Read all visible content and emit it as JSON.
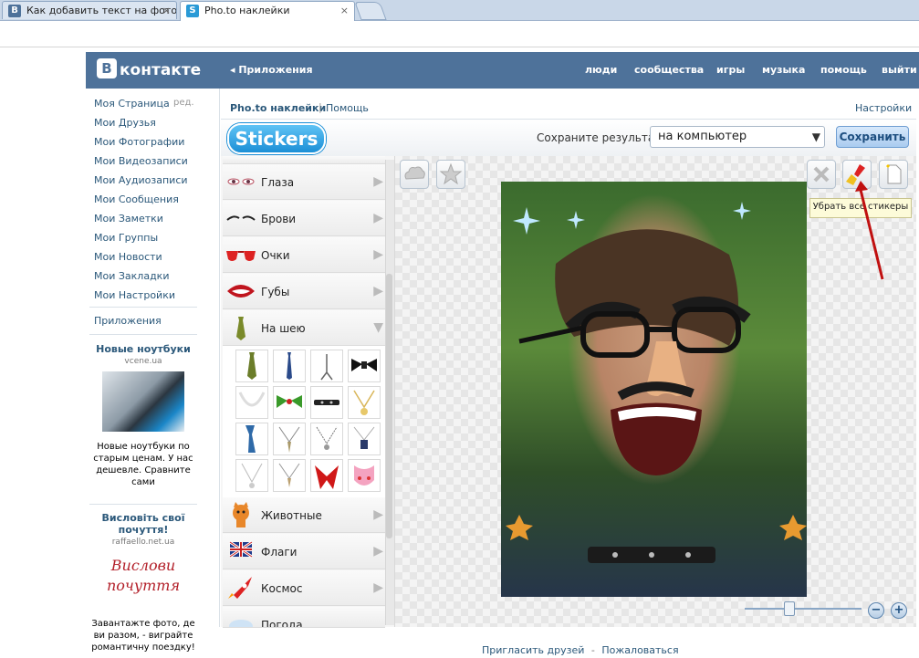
{
  "browser": {
    "tabs": [
      {
        "favicon": "B",
        "title": "Как добавить текст на фото",
        "active": false,
        "favicon_color": "#4e729a"
      },
      {
        "favicon": "S",
        "title": "Pho.to наклейки",
        "active": true,
        "favicon_color": "#2a9ad6"
      }
    ],
    "close_glyph": "×"
  },
  "vk": {
    "logo_letter": "В",
    "logo_text": "контакте",
    "apps_label": "◂ Приложения",
    "nav": [
      "люди",
      "сообщества",
      "игры",
      "музыка",
      "помощь",
      "выйти"
    ],
    "menu": [
      "Моя Страница",
      "Мои Друзья",
      "Мои Фотографии",
      "Мои Видеозаписи",
      "Мои Аудиозаписи",
      "Мои Сообщения",
      "Мои Заметки",
      "Мои Группы",
      "Мои Новости",
      "Мои Закладки",
      "Мои Настройки"
    ],
    "menu_edit": "ред.",
    "apps_menu": "Приложения",
    "ads": [
      {
        "title": "Новые ноутбуки",
        "site": "vcene.ua",
        "text": "Новые ноутбуки по старым ценам. У нас дешевле. Сравните сами"
      },
      {
        "title": "Висловіть свої почуття!",
        "site": "raffaello.net.ua",
        "image_text": "Вислови почуття",
        "text": "Завантажте фото, де ви разом, - виграйте романтичну поездку!"
      }
    ]
  },
  "app": {
    "title": "Pho.to наклейки",
    "separator": "|",
    "help": "Помощь",
    "settings": "Настройки",
    "logo": "Stickers",
    "save_label": "Сохраните результат",
    "save_target": "на компьютер",
    "save_button": "Сохранить",
    "select_arrow": "▼",
    "tooltip": "Убрать все стикеры",
    "categories": [
      {
        "label": "Глаза",
        "open": false
      },
      {
        "label": "Брови",
        "open": false
      },
      {
        "label": "Очки",
        "open": false
      },
      {
        "label": "Губы",
        "open": false
      },
      {
        "label": "На шею",
        "open": true
      },
      {
        "label": "Животные",
        "open": false
      },
      {
        "label": "Флаги",
        "open": false
      },
      {
        "label": "Космос",
        "open": false
      },
      {
        "label": "Погода",
        "open": false
      }
    ],
    "arrow_closed": "▶",
    "arrow_open": "▼",
    "neck_items": [
      "tie-striped",
      "tie-blue",
      "tie-pin",
      "bow-tie-black",
      "necklace-pearl",
      "bow-tie-green",
      "choker",
      "pendant-gold",
      "scarf-blue",
      "fang-necklace",
      "chain-pendant",
      "tag-necklace",
      "pendant-silver",
      "tooth-necklace",
      "bandana-red",
      "bib-pink"
    ],
    "zoom_minus": "−",
    "zoom_plus": "+",
    "zoom_level": 0.38
  },
  "footer": {
    "invite": "Пригласить друзей",
    "dash": "-",
    "complain": "Пожаловаться"
  }
}
